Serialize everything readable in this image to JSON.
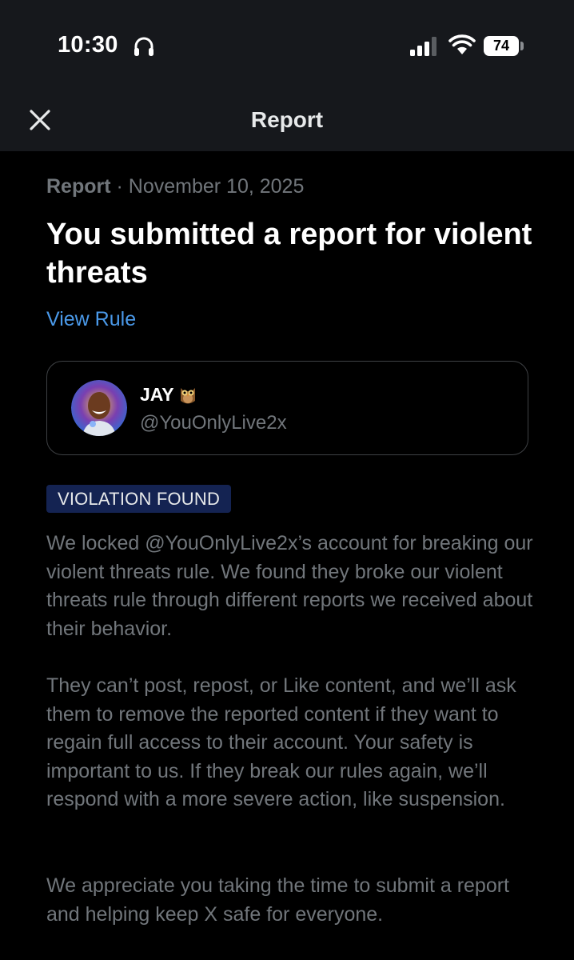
{
  "status_bar": {
    "time": "10:30",
    "battery": "74",
    "icons": [
      "headphones-icon",
      "signal-icon",
      "wifi-icon",
      "battery-icon"
    ]
  },
  "nav": {
    "close_icon": "close-icon",
    "title": "Report"
  },
  "report": {
    "label": "Report",
    "date": " · November 10, 2025",
    "headline": "You submitted a report for violent threats",
    "view_rule": "View Rule"
  },
  "user": {
    "name": "JAY",
    "emoji_icon": "owl-icon",
    "handle": "@YouOnlyLive2x"
  },
  "badge": "VIOLATION FOUND",
  "paragraphs": [
    "We locked @YouOnlyLive2x’s account for breaking our violent threats rule. We found they broke our violent threats rule through different reports we received about their behavior.",
    "They can’t post, repost, or Like content, and we’ll ask them to remove the reported content if they want to regain full access to their account. Your safety is important to us. If they break our rules again, we’ll respond with a more severe action, like suspension.",
    "We appreciate you taking the time to submit a report and helping keep X safe for everyone."
  ],
  "colors": {
    "background": "#000000",
    "header": "#16181c",
    "link": "#4a99e9",
    "badge_bg": "#142352",
    "muted_text": "#71767b"
  }
}
